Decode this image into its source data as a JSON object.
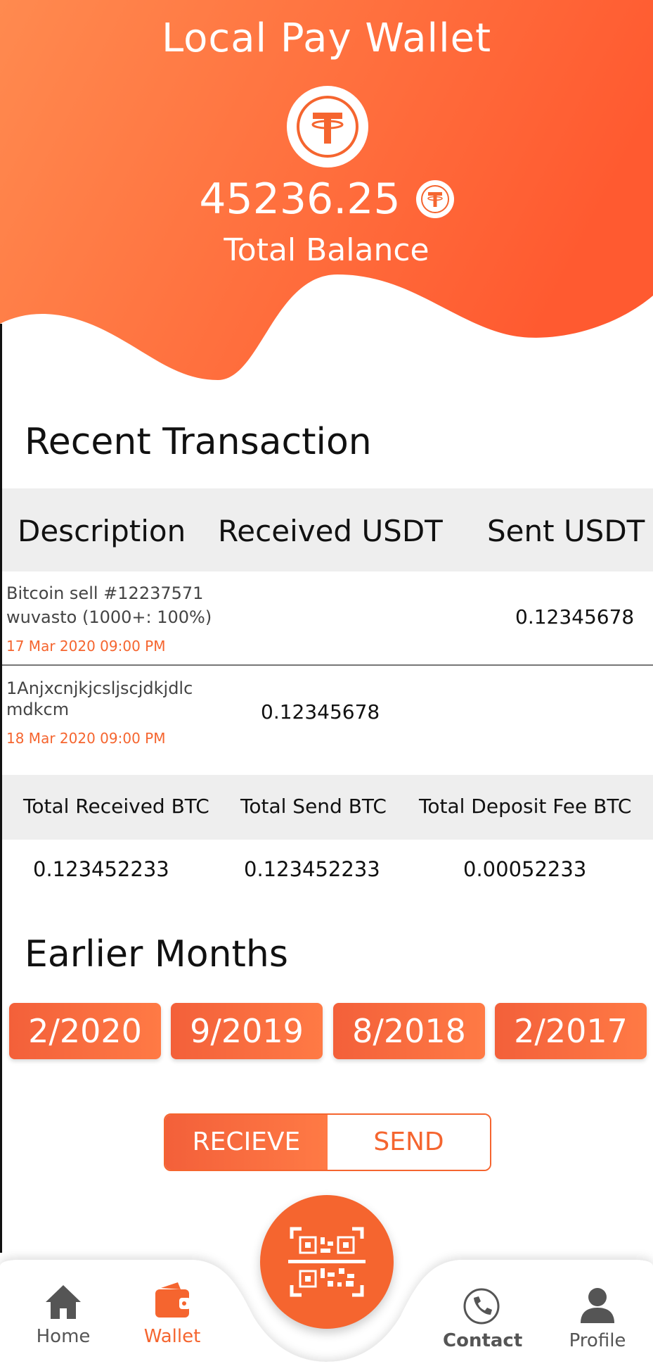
{
  "header": {
    "title": "Local Pay Wallet",
    "balance": "45236.25",
    "balance_label": "Total Balance",
    "token_icon": "tether-icon"
  },
  "recent": {
    "title": "Recent Transaction",
    "columns": [
      "Description",
      "Received USDT",
      "Sent USDT"
    ],
    "transactions": [
      {
        "desc_line1": "Bitcoin sell #12237571",
        "desc_line2": "wuvasto (1000+: 100%)",
        "date": "17 Mar 2020 09:00 PM",
        "received": "",
        "sent": "0.12345678"
      },
      {
        "desc_line1": "1Anjxcnjkjcsljscjdkjdlc",
        "desc_line2": "mdkcm",
        "date": "18 Mar 2020 09:00 PM",
        "received": "0.12345678",
        "sent": ""
      }
    ]
  },
  "totals": {
    "headers": [
      "Total Received BTC",
      "Total Send BTC",
      "Total Deposit Fee BTC"
    ],
    "values": [
      "0.123452233",
      "0.123452233",
      "0.00052233"
    ]
  },
  "earlier": {
    "title": "Earlier Months",
    "months": [
      "2/2020",
      "9/2019",
      "8/2018",
      "2/2017"
    ]
  },
  "toggle": {
    "receive": "RECIEVE",
    "send": "SEND",
    "active": "receive"
  },
  "nav": {
    "home": "Home",
    "wallet": "Wallet",
    "contact": "Contact",
    "profile": "Profile",
    "active": "wallet"
  },
  "colors": {
    "accent": "#f5652f",
    "accent_light": "#ff8a4f",
    "nav_inactive": "#555555",
    "table_header_bg": "#eeeeee"
  }
}
